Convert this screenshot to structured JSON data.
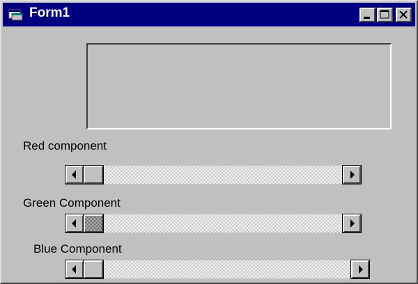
{
  "window": {
    "title": "Form1",
    "icons": {
      "app": "form-icon",
      "minimize": "minimize-icon",
      "maximize": "maximize-icon",
      "close": "close-icon"
    }
  },
  "picture_box": {
    "content": ""
  },
  "sliders": [
    {
      "label": "Red component",
      "value_fraction": 0.0,
      "focused": false
    },
    {
      "label": "Green Component",
      "value_fraction": 0.0,
      "focused": true
    },
    {
      "label": "Blue Component",
      "value_fraction": 0.0,
      "focused": false
    }
  ],
  "colors": {
    "titlebar": "#000080",
    "face": "#c0c0c0"
  }
}
